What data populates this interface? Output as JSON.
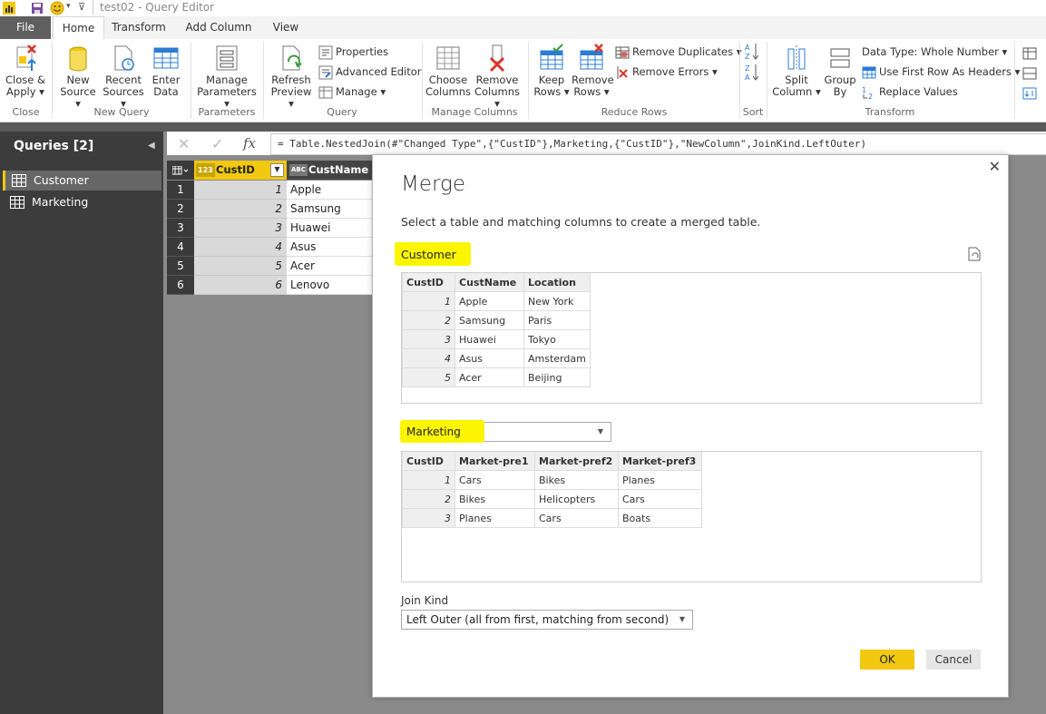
{
  "window": {
    "title": "test02 - Query Editor"
  },
  "tabs": [
    "File",
    "Home",
    "Transform",
    "Add Column",
    "View"
  ],
  "ribbon": {
    "close_apply": [
      "Close &",
      "Apply ▾"
    ],
    "new_source": [
      "New",
      "Source ▾"
    ],
    "recent_sources": [
      "Recent",
      "Sources ▾"
    ],
    "enter_data": [
      "Enter",
      "Data"
    ],
    "manage_parameters": [
      "Manage",
      "Parameters ▾"
    ],
    "refresh_preview": [
      "Refresh",
      "Preview ▾"
    ],
    "properties": "Properties",
    "advanced_editor": "Advanced Editor",
    "manage": "Manage ▾",
    "choose_columns": [
      "Choose",
      "Columns"
    ],
    "remove_columns": [
      "Remove",
      "Columns ▾"
    ],
    "keep_rows": [
      "Keep",
      "Rows ▾"
    ],
    "remove_rows": [
      "Remove",
      "Rows ▾"
    ],
    "remove_duplicates": "Remove Duplicates ▾",
    "remove_errors": "Remove Errors ▾",
    "split_column": [
      "Split",
      "Column ▾"
    ],
    "group_by": [
      "Group",
      "By"
    ],
    "data_type": "Data Type: Whole Number ▾",
    "use_first_row": "Use First Row As Headers ▾",
    "replace_values": "Replace Values",
    "groups": {
      "close": "Close",
      "new_query": "New Query",
      "parameters": "Parameters",
      "query": "Query",
      "manage_columns": "Manage Columns",
      "reduce_rows": "Reduce Rows",
      "sort": "Sort",
      "transform": "Transform"
    }
  },
  "queries": {
    "header": "Queries [2]",
    "items": [
      "Customer",
      "Marketing"
    ]
  },
  "formula": "= Table.NestedJoin(#\"Changed Type\",{\"CustID\"},Marketing,{\"CustID\"},\"NewColumn\",JoinKind.LeftOuter)",
  "grid": {
    "col1_type": "123",
    "col1": "CustID",
    "col2_type": "ABC",
    "col2": "CustName",
    "rows": [
      {
        "n": "1",
        "id": "1",
        "name": "Apple"
      },
      {
        "n": "2",
        "id": "2",
        "name": "Samsung"
      },
      {
        "n": "3",
        "id": "3",
        "name": "Huawei"
      },
      {
        "n": "4",
        "id": "4",
        "name": "Asus"
      },
      {
        "n": "5",
        "id": "5",
        "name": "Acer"
      },
      {
        "n": "6",
        "id": "6",
        "name": "Lenovo"
      }
    ]
  },
  "dialog": {
    "title": "Merge",
    "description": "Select a table and matching columns to create a merged table.",
    "first_table": "Customer",
    "customer_headers": [
      "CustID",
      "CustName",
      "Location"
    ],
    "customer_rows": [
      [
        "1",
        "Apple",
        "New York"
      ],
      [
        "2",
        "Samsung",
        "Paris"
      ],
      [
        "3",
        "Huawei",
        "Tokyo"
      ],
      [
        "4",
        "Asus",
        "Amsterdam"
      ],
      [
        "5",
        "Acer",
        "Beijing"
      ]
    ],
    "second_table": "Marketing",
    "marketing_headers": [
      "CustID",
      "Market-pre1",
      "Market-pref2",
      "Market-pref3"
    ],
    "marketing_rows": [
      [
        "1",
        "Cars",
        "Bikes",
        "Planes"
      ],
      [
        "2",
        "Bikes",
        "Helicopters",
        "Cars"
      ],
      [
        "3",
        "Planes",
        "Cars",
        "Boats"
      ]
    ],
    "join_kind_label": "Join Kind",
    "join_kind": "Left Outer (all from first, matching from second)",
    "ok": "OK",
    "cancel": "Cancel"
  },
  "colors": {
    "accent": "#f2c811",
    "highlight": "#fbf500",
    "dark_pane": "#3c3c3c"
  }
}
